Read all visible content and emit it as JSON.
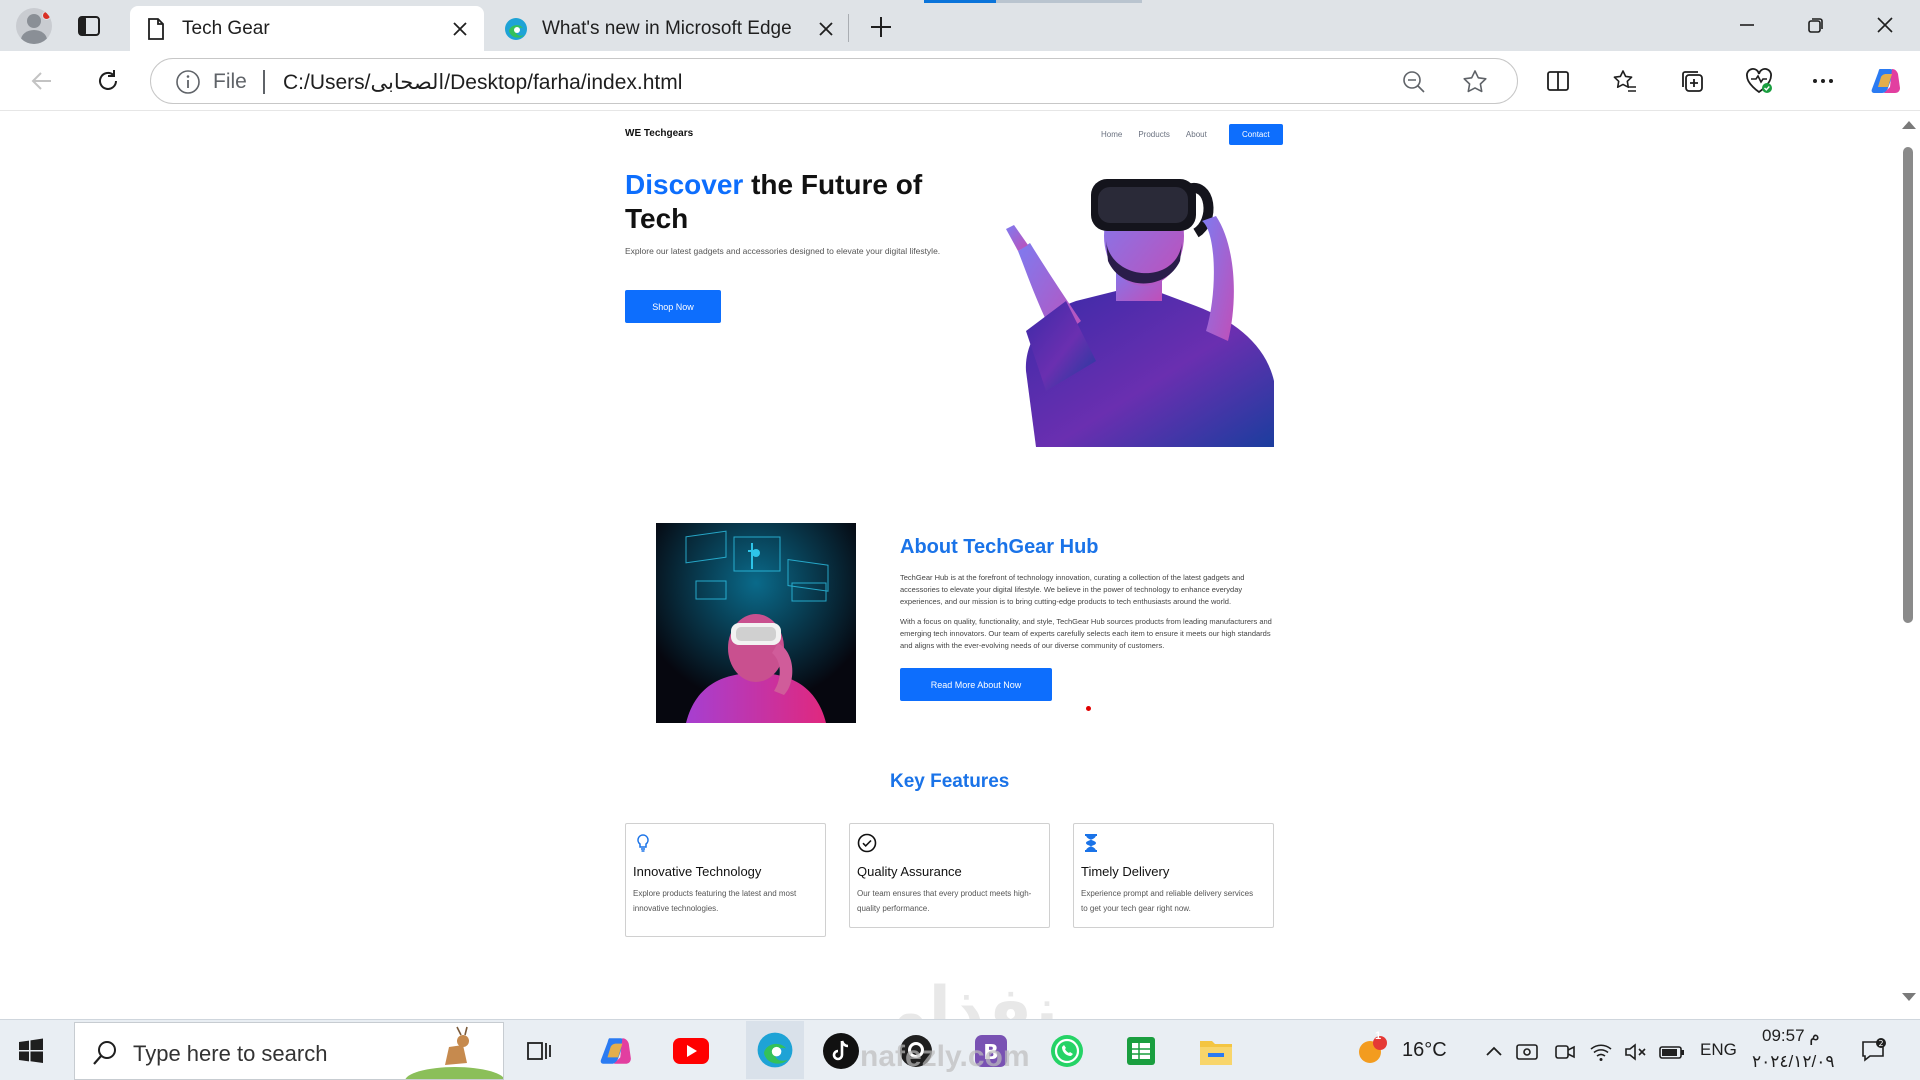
{
  "browser": {
    "tabs": [
      {
        "title": "Tech Gear",
        "active": true
      },
      {
        "title": "What's new in Microsoft Edge",
        "active": false
      }
    ],
    "address": {
      "scheme_label": "File",
      "url": "C:/Users/الصحابى/Desktop/farha/index.html"
    }
  },
  "site": {
    "brand": "WE Techgears",
    "nav": [
      "Home",
      "Products",
      "About"
    ],
    "contact_label": "Contact",
    "hero": {
      "title_accent": "Discover",
      "title_rest": " the Future of Tech",
      "subtitle": "Explore our latest gadgets and accessories designed to elevate your digital lifestyle.",
      "button": "Shop Now"
    },
    "about": {
      "title": "About TechGear Hub",
      "p1": "TechGear Hub is at the forefront of technology innovation, curating a collection of the latest gadgets and accessories to elevate your digital lifestyle. We believe in the power of technology to enhance everyday experiences, and our mission is to bring cutting-edge products to tech enthusiasts around the world.",
      "p2": "With a focus on quality, functionality, and style, TechGear Hub sources products from leading manufacturers and emerging tech innovators. Our team of experts carefully selects each item to ensure it meets our high standards and aligns with the ever-evolving needs of our diverse community of customers.",
      "button": "Read More About Now"
    },
    "features": {
      "title": "Key Features",
      "cards": [
        {
          "title": "Innovative Technology",
          "desc": "Explore products featuring the latest and most innovative technologies.",
          "icon": "lightbulb-icon"
        },
        {
          "title": "Quality Assurance",
          "desc": "Our team ensures that every product meets high-quality performance.",
          "icon": "check-circle-icon"
        },
        {
          "title": "Timely Delivery",
          "desc": "Experience prompt and reliable delivery services to get your tech gear right now.",
          "icon": "hourglass-icon"
        }
      ]
    }
  },
  "watermark": "نفذلي",
  "watermark_sub": "nafezly.com",
  "taskbar": {
    "search_placeholder": "Type here to search",
    "weather": "16°C",
    "weather_badge": "1",
    "language": "ENG",
    "time": "09:57 م",
    "date": "٢٠٢٤/١٢/٠٩"
  },
  "colors": {
    "accent": "#0d6efd",
    "heading_blue": "#1a73e8"
  }
}
